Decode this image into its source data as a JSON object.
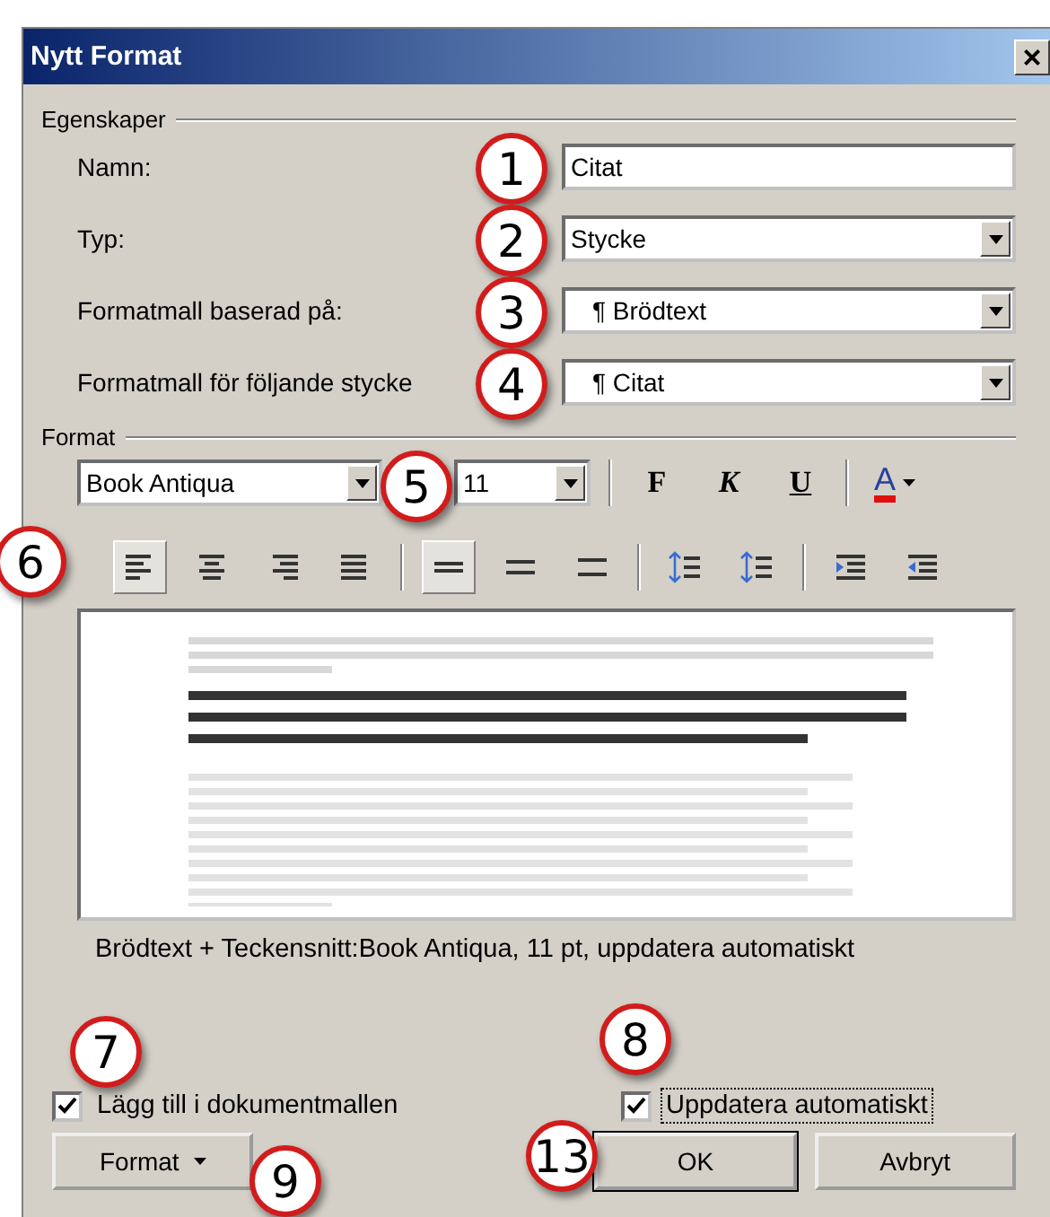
{
  "window": {
    "title": "Nytt Format",
    "close": "×"
  },
  "properties": {
    "legend": "Egenskaper",
    "fields": [
      {
        "kind": "text",
        "label": "Namn:",
        "value": "Citat"
      },
      {
        "kind": "select",
        "label": "Typ:",
        "value": "Stycke"
      },
      {
        "kind": "select",
        "label": "Formatmall baserad på:",
        "value": "¶ Brödtext"
      },
      {
        "kind": "select",
        "label": "Formatmall för följande stycke",
        "value": "¶ Citat"
      }
    ]
  },
  "format": {
    "legend": "Format",
    "font": "Book Antiqua",
    "size": "11",
    "style_buttons": [
      {
        "kind": "bold",
        "label": "F"
      },
      {
        "kind": "italic",
        "label": "K"
      },
      {
        "kind": "underline",
        "label": "U"
      }
    ],
    "font_color": {
      "label": "A",
      "color": "#e01010"
    },
    "alignment": [
      {
        "kind": "left",
        "selected": true
      },
      {
        "kind": "center",
        "selected": false
      },
      {
        "kind": "right",
        "selected": false
      },
      {
        "kind": "justify",
        "selected": false
      }
    ],
    "spacing": [
      {
        "kind": "single",
        "selected": true
      },
      {
        "kind": "one_half",
        "selected": false
      },
      {
        "kind": "double",
        "selected": false
      }
    ],
    "description": "Brödtext + Teckensnitt:Book Antiqua, 11 pt, uppdatera automatiskt"
  },
  "checkboxes": [
    {
      "label": "Lägg till i dokumentmallen",
      "checked": true
    },
    {
      "label": "Uppdatera automatiskt",
      "checked": true
    }
  ],
  "buttons": [
    {
      "kind": "menu",
      "label": "Format"
    },
    {
      "kind": "default",
      "label": "OK"
    },
    {
      "kind": "plain",
      "label": "Avbryt"
    }
  ],
  "callouts": [
    "1",
    "2",
    "3",
    "4",
    "5",
    "6",
    "7",
    "8",
    "9",
    "13"
  ]
}
